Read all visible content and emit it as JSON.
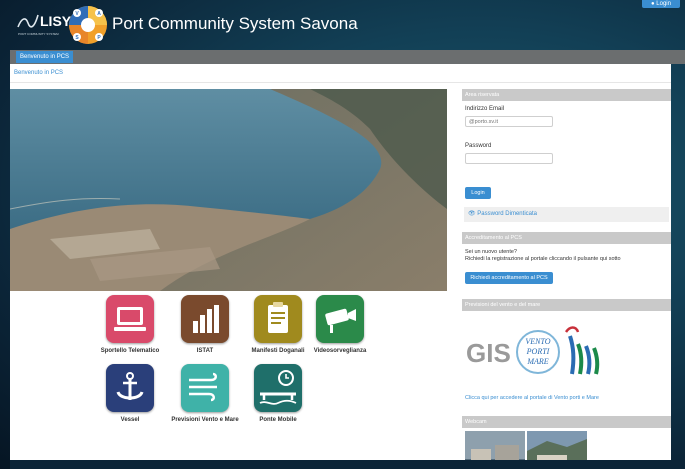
{
  "header": {
    "lisy_brand": "LISY",
    "lisy_sub": "PORT COMMUNITY SYSTEM",
    "circle_letters": [
      "V",
      "A",
      "P",
      "S"
    ],
    "title": "Port Community System Savona",
    "login_label": "Login"
  },
  "nav": {
    "active_tab": "Benvenuto in PCS"
  },
  "breadcrumb": "Benvenuto in PCS",
  "tiles": [
    {
      "label": "Sportello Telematico",
      "icon": "computer-icon",
      "color": "#d94a6a"
    },
    {
      "label": "ISTAT",
      "icon": "bar-chart-icon",
      "color": "#7a4a2d"
    },
    {
      "label": "Manifesti Doganali",
      "icon": "clipboard-icon",
      "color": "#a08a1e"
    },
    {
      "label": "Videosorveglianza",
      "icon": "camera-icon",
      "color": "#2b8a4a"
    },
    {
      "label": "Vessel",
      "icon": "anchor-icon",
      "color": "#2a3f7a"
    },
    {
      "label": "Previsioni Vento e Mare",
      "icon": "wind-icon",
      "color": "#3fb2a8"
    },
    {
      "label": "Ponte Mobile",
      "icon": "bridge-clock-icon",
      "color": "#1f6f6a"
    }
  ],
  "login_panel": {
    "title": "Area riservata",
    "email_label": "Indirizzo Email",
    "email_placeholder": "@porto.sv.it",
    "password_label": "Password",
    "login_button": "Login",
    "forgot": "Password Dimenticata"
  },
  "accreditation": {
    "title": "Accreditamento al PCS",
    "line1": "Sei un nuovo utente?",
    "line2": "Richiedi la registrazione al portale cliccando il pulsante qui sotto",
    "button": "Richiedi accreditamento al PCS"
  },
  "forecast": {
    "title": "Previsioni del vento e del mare",
    "gis": "GIS",
    "badge_lines": [
      "VENTO",
      "PORTI",
      "MARE"
    ],
    "link": "Clicca qui per accedere al portale di Vento porti e Mare"
  },
  "webcam": {
    "title": "Webcam"
  },
  "colors": {
    "accent": "#3a8ed1",
    "navbar": "#6b6e6f",
    "panel_header": "#c9c9c9"
  }
}
